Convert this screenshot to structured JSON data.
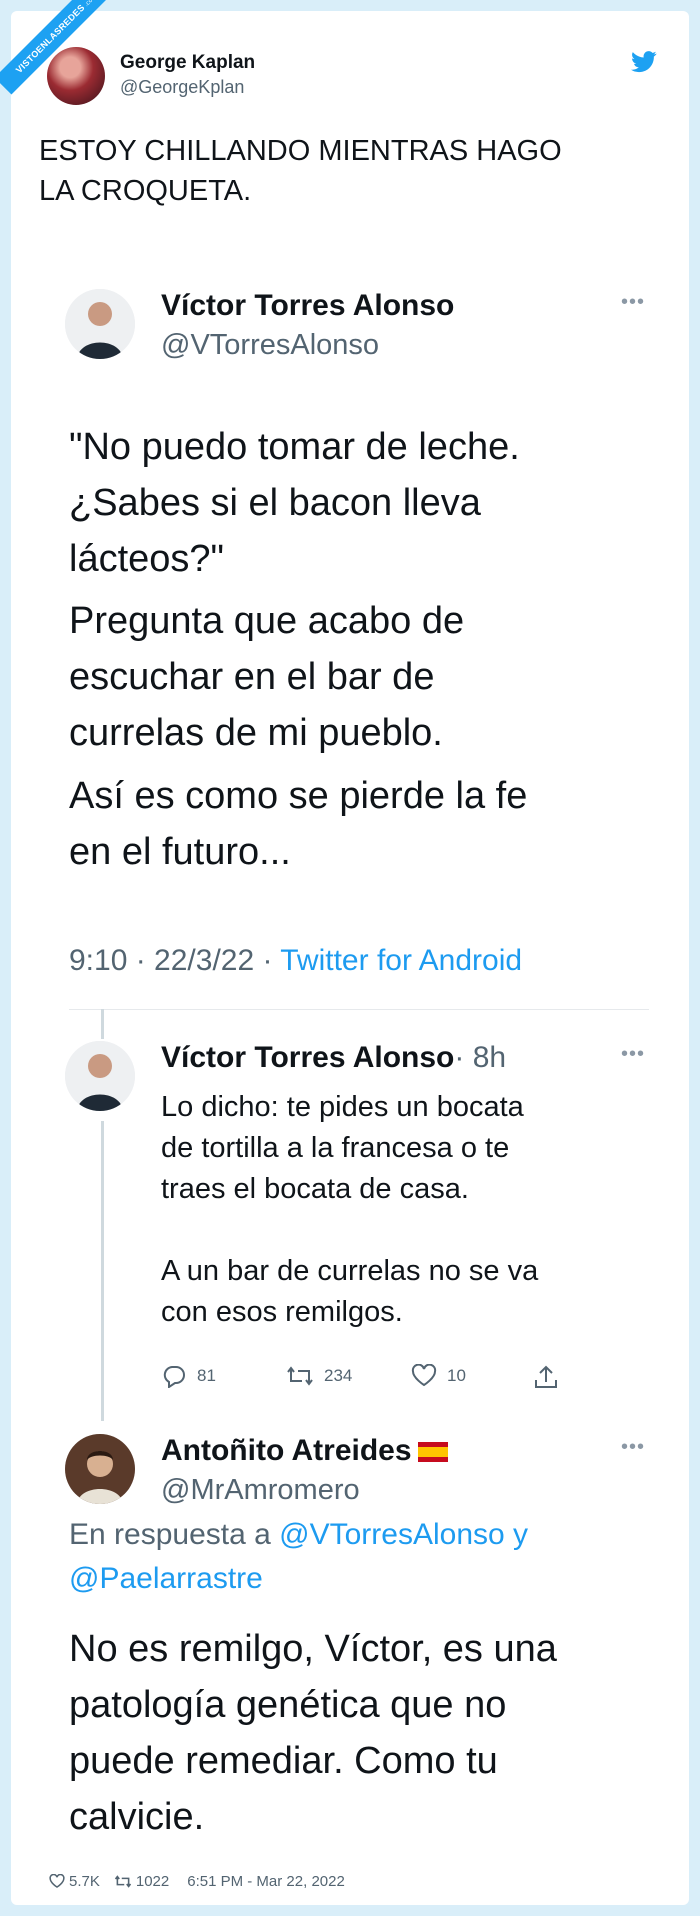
{
  "watermark": {
    "text": "VISTOENLASREDES",
    "suffix": ".com"
  },
  "author": {
    "name": "George Kaplan",
    "handle": "@GeorgeKplan"
  },
  "tweet_text": "ESTOY CHILLANDO MIENTRAS HAGO\nLA CROQUETA.",
  "screenshot": {
    "main": {
      "name": "Víctor Torres Alonso",
      "handle": "@VTorresAlonso",
      "body": "\"No puedo tomar de leche.\n¿Sabes si el bacon lleva\nlácteos?\"",
      "body2": "Pregunta que acabo de\nescuchar en el bar de\ncurrelas de mi pueblo.",
      "body3": "Así es como se pierde la fe\nen el futuro...",
      "time": "9:10 · 22/3/22 · ",
      "client": "Twitter for Android"
    },
    "reply1": {
      "name": "Víctor Torres Alonso",
      "age": "· 8h",
      "body": "Lo dicho: te pides un bocata\nde tortilla a la francesa o te\ntraes el bocata de casa.\n\nA un bar de currelas no se va\ncon esos remilgos.",
      "replies": "81",
      "retweets": "234",
      "likes": "10"
    },
    "reply2": {
      "name": "Antoñito Atreides",
      "handle": "@MrAmromero",
      "in_reply_prefix": "En respuesta a ",
      "in_reply_users": "@VTorresAlonso y\n@Paelarrastre",
      "body": "No es remilgo, Víctor, es una\npatología genética que no\npuede remediar. Como tu\ncalvicie."
    }
  },
  "footer": {
    "likes": "5.7K",
    "retweets": "1022",
    "timestamp": "6:51 PM - Mar 22, 2022"
  },
  "colors": {
    "twitter_blue": "#1da1f2",
    "link": "#1d9bf0",
    "muted": "#536471"
  }
}
